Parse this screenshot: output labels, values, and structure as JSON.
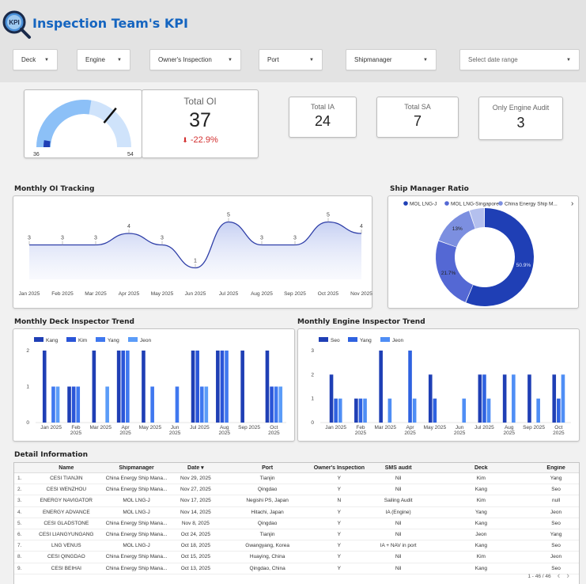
{
  "header": {
    "title": "Inspection Team's KPI",
    "logo_text": "KPI"
  },
  "filters": [
    {
      "label": "Deck"
    },
    {
      "label": "Engine"
    },
    {
      "label": "Owner's Inspection"
    },
    {
      "label": "Port"
    },
    {
      "label": "Shipmanager"
    },
    {
      "label": "Select date range"
    }
  ],
  "gauge": {
    "min": "36",
    "max": "54",
    "value": 37,
    "min_value": 36,
    "max_value": 54,
    "target_fraction": 0.72
  },
  "kpi": {
    "total_oi": {
      "label": "Total OI",
      "value": "37",
      "delta": "-22.9%"
    },
    "total_ia": {
      "label": "Total IA",
      "value": "24"
    },
    "total_sa": {
      "label": "Total SA",
      "value": "7"
    },
    "engine_audit": {
      "label": "Only Engine Audit",
      "value": "3"
    }
  },
  "colors": {
    "accent": "#1565c0",
    "dark_blue": "#1f3fb5",
    "mid_blue": "#3a6de8",
    "light_blue": "#5b8ef2",
    "negative": "#d32f2f"
  },
  "sections": {
    "monthly_oi": "Monthly OI Tracking",
    "ship_manager_ratio": "Ship Manager Ratio",
    "deck_trend": "Monthly Deck Inspector Trend",
    "engine_trend": "Monthly Engine Inspector Trend",
    "detail": "Detail Information"
  },
  "chart_data": [
    {
      "type": "area",
      "title": "Monthly OI Tracking",
      "categories": [
        "Jan 2025",
        "Feb 2025",
        "Mar 2025",
        "Apr 2025",
        "May 2025",
        "Jun 2025",
        "Jul 2025",
        "Aug 2025",
        "Sep 2025",
        "Oct 2025",
        "Nov 2025"
      ],
      "values": [
        3,
        3,
        3,
        4,
        3,
        1,
        5,
        3,
        3,
        5,
        4
      ],
      "ylim": [
        0,
        6
      ]
    },
    {
      "type": "pie",
      "title": "Ship Manager Ratio",
      "legend": [
        "MOL LNG-J",
        "MOL LNG-Singapore",
        "China Energy Ship M..."
      ],
      "values": [
        50.9,
        21.7,
        13,
        4.5
      ],
      "labels": [
        "50.9%",
        "21.7%",
        "13%",
        ""
      ],
      "colors": [
        "#1f3fb5",
        "#5468d4",
        "#7c8fe0",
        "#b4c0ee"
      ]
    },
    {
      "type": "bar",
      "title": "Monthly Deck Inspector Trend",
      "categories": [
        "Jan 2025",
        "Feb 2025",
        "Mar 2025",
        "Apr 2025",
        "May 2025",
        "Jun 2025",
        "Jul 2025",
        "Aug 2025",
        "Sep 2025",
        "Oct 2025"
      ],
      "series": [
        {
          "name": "Kang",
          "values": [
            2,
            1,
            2,
            2,
            2,
            0,
            2,
            2,
            2,
            2
          ]
        },
        {
          "name": "Kim",
          "values": [
            0,
            1,
            0,
            2,
            0,
            0,
            2,
            2,
            0,
            1
          ]
        },
        {
          "name": "Yang",
          "values": [
            1,
            1,
            0,
            2,
            1,
            1,
            1,
            2,
            0,
            1
          ]
        },
        {
          "name": "Jeon",
          "values": [
            1,
            0,
            1,
            0,
            0,
            0,
            1,
            0,
            0,
            1
          ]
        }
      ],
      "yticks": [
        0,
        1,
        2
      ],
      "ylim": [
        0,
        2
      ],
      "colors": [
        "#1f3fb5",
        "#2a55d8",
        "#3f78ef",
        "#5b9cf8"
      ]
    },
    {
      "type": "bar",
      "title": "Monthly Engine Inspector Trend",
      "categories": [
        "Jan 2025",
        "Feb 2025",
        "Mar 2025",
        "Apr 2025",
        "May 2025",
        "Jun 2025",
        "Jul 2025",
        "Aug 2025",
        "Sep 2025",
        "Oct 2025"
      ],
      "series": [
        {
          "name": "Seo",
          "values": [
            2,
            1,
            3,
            0,
            2,
            0,
            2,
            2,
            2,
            2
          ]
        },
        {
          "name": "Yang",
          "values": [
            1,
            1,
            0,
            3,
            1,
            0,
            2,
            0,
            0,
            1
          ]
        },
        {
          "name": "Jeon",
          "values": [
            1,
            1,
            1,
            1,
            0,
            1,
            1,
            2,
            1,
            2
          ]
        }
      ],
      "yticks": [
        0,
        1,
        2,
        3
      ],
      "ylim": [
        0,
        3
      ],
      "colors": [
        "#1f3fb5",
        "#2f62e0",
        "#4f8ef5"
      ]
    }
  ],
  "table": {
    "headers": [
      "",
      "Name",
      "Shipmanager",
      "Date ▾",
      "Port",
      "Owner's Inspection",
      "SMS audit",
      "Deck",
      "Engine"
    ],
    "rows": [
      [
        "1.",
        "CESI TIANJIN",
        "China Energy Ship Mana...",
        "Nov 29, 2025",
        "Tianjin",
        "Y",
        "Nil",
        "Kim",
        "Yang"
      ],
      [
        "2.",
        "CESI WENZHOU",
        "China Energy Ship Mana...",
        "Nov 27, 2025",
        "Qingdao",
        "Y",
        "Nil",
        "Kang",
        "Seo"
      ],
      [
        "3.",
        "ENERGY NAVIGATOR",
        "MOL LNG-J",
        "Nov 17, 2025",
        "Negishi PS, Japan",
        "N",
        "Sailing Audit",
        "Kim",
        "null"
      ],
      [
        "4.",
        "ENERGY ADVANCE",
        "MOL LNG-J",
        "Nov 14, 2025",
        "Hitachi, Japan",
        "Y",
        "IA (Engine)",
        "Yang",
        "Jeon"
      ],
      [
        "5.",
        "CESI GLADSTONE",
        "China Energy Ship Mana...",
        "Nov 8, 2025",
        "Qingdao",
        "Y",
        "Nil",
        "Kang",
        "Seo"
      ],
      [
        "6.",
        "CESI LIANGYUNGANG",
        "China Energy Ship Mana...",
        "Oct 24, 2025",
        "Tianjin",
        "Y",
        "Nil",
        "Jeon",
        "Yang"
      ],
      [
        "7.",
        "LNG VENUS",
        "MOL LNG-J",
        "Oct 18, 2025",
        "Gwangyang, Korea",
        "Y",
        "IA + NAV in port",
        "Kang",
        "Seo"
      ],
      [
        "8.",
        "CESI QINGDAO",
        "China Energy Ship Mana...",
        "Oct 15, 2025",
        "Huaying, China",
        "Y",
        "Nil",
        "Kim",
        "Jeon"
      ],
      [
        "9.",
        "CESI BEIHAI",
        "China Energy Ship Mana...",
        "Oct 13, 2025",
        "Qingdao, China",
        "Y",
        "Nil",
        "Kang",
        "Seo"
      ]
    ],
    "pagination": "1 - 46 / 46"
  }
}
